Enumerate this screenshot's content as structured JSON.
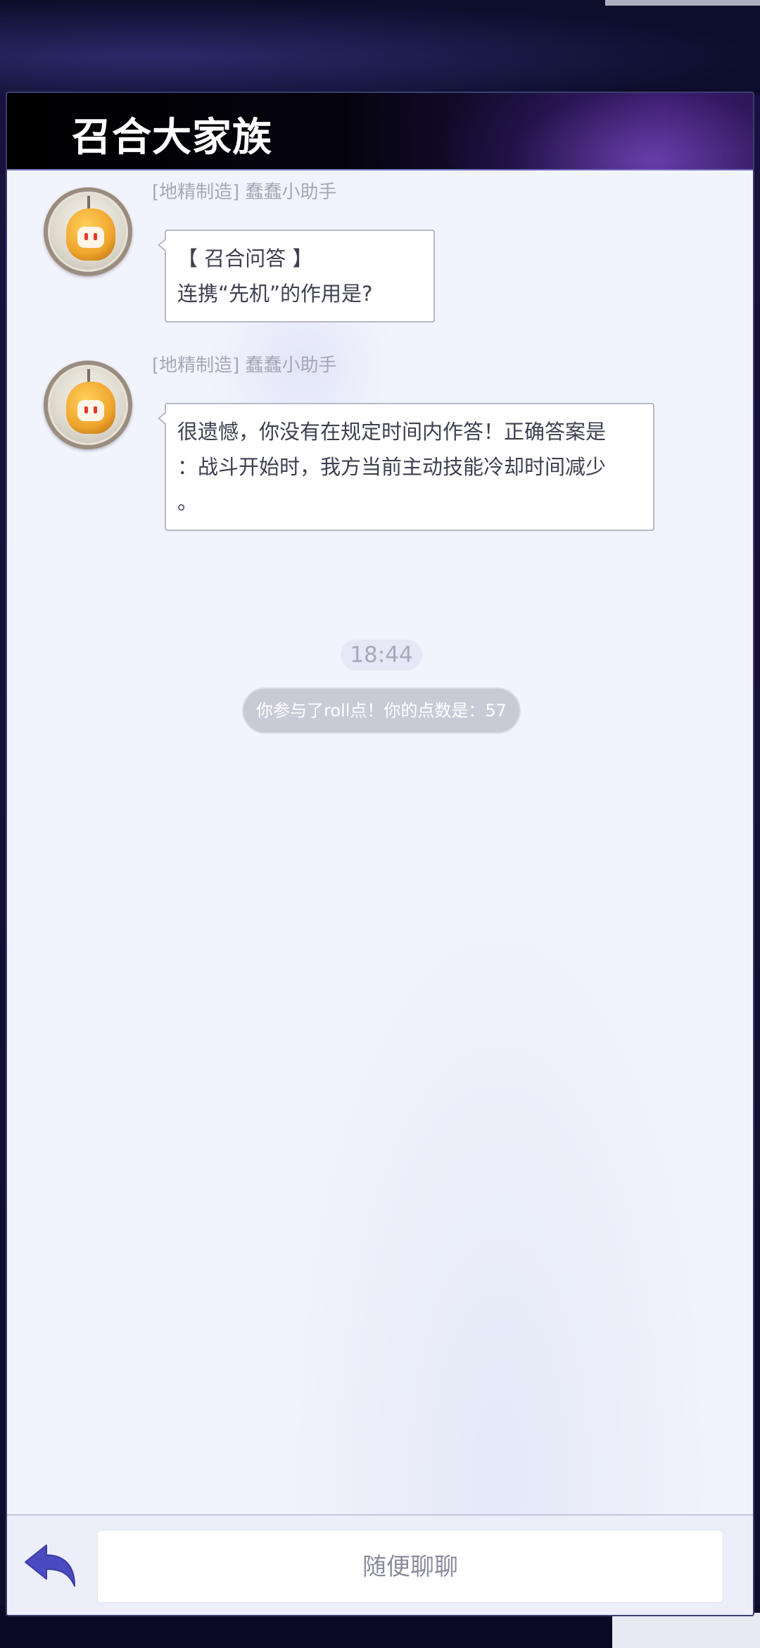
{
  "panel": {
    "title": "召合大家族"
  },
  "messages": [
    {
      "sender": "[地精制造] 蠢蠢小助手",
      "lines": [
        "【 召合问答 】",
        "连携“先机”的作用是?"
      ]
    },
    {
      "sender": "[地精制造] 蠢蠢小助手",
      "lines": [
        "很遗憾，你没有在规定时间内作答！正确答案是",
        "：战斗开始时，我方当前主动技能冷却时间减少",
        "。"
      ]
    }
  ],
  "timestamp": "18:44",
  "system_message": "你参与了roll点！你的点数是：57",
  "input": {
    "placeholder": "随便聊聊"
  },
  "icons": {
    "back": "back-arrow-icon",
    "avatar": "robot-avatar-icon"
  },
  "colors": {
    "accent": "#4a4bbf",
    "panel_bg": "#f2f4fd"
  }
}
